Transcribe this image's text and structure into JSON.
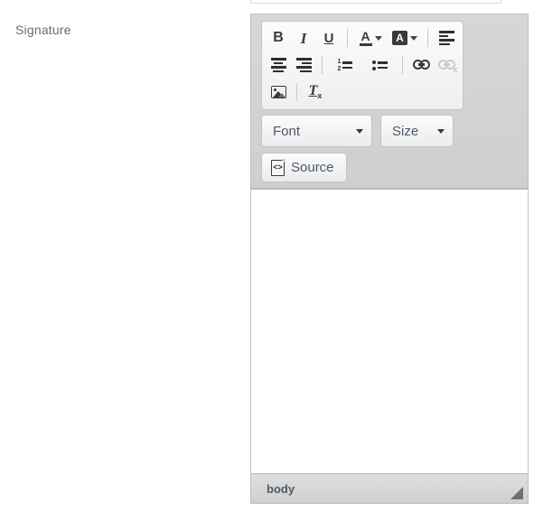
{
  "form": {
    "label": "Signature"
  },
  "editor": {
    "toolbar": {
      "row1": [
        {
          "name": "bold",
          "glyph": "B",
          "title": "Bold",
          "enabled": true
        },
        {
          "name": "italic",
          "glyph": "I",
          "title": "Italic",
          "enabled": true
        },
        {
          "name": "underline",
          "glyph": "U",
          "title": "Underline",
          "enabled": true
        },
        {
          "name": "text-color",
          "glyph": "A",
          "title": "Text Color",
          "enabled": true
        },
        {
          "name": "bg-color",
          "glyph": "A",
          "title": "Background Color",
          "enabled": true
        },
        {
          "name": "align-left",
          "glyph": "",
          "title": "Align Left",
          "enabled": true
        }
      ],
      "row2": [
        {
          "name": "align-center",
          "title": "Center",
          "enabled": true
        },
        {
          "name": "align-right",
          "title": "Align Right",
          "enabled": true
        },
        {
          "name": "numbered-list",
          "title": "Numbered List",
          "enabled": true
        },
        {
          "name": "bulleted-list",
          "title": "Bulleted List",
          "enabled": true
        },
        {
          "name": "link",
          "title": "Link",
          "enabled": true
        },
        {
          "name": "unlink",
          "title": "Unlink",
          "enabled": false
        }
      ],
      "row3": [
        {
          "name": "image",
          "title": "Image",
          "enabled": true
        },
        {
          "name": "remove-format",
          "title": "Remove Format",
          "enabled": true
        }
      ],
      "list_markers": {
        "numbered": [
          "1",
          "2"
        ]
      },
      "remove_format_glyph": {
        "letter": "T",
        "subscript": "x"
      }
    },
    "combos": [
      {
        "name": "font",
        "label": "Font"
      },
      {
        "name": "size",
        "label": "Size"
      }
    ],
    "source_button": {
      "label": "Source",
      "icon_glyph": "<>"
    },
    "content": "",
    "statusbar": {
      "element_path": "body"
    }
  },
  "colors": {
    "toolbar_bg": "#d4d4d4",
    "panel_bg": "#f5f5f5",
    "editor_border": "#c0c0c0",
    "label_text": "#6b6b6b",
    "combo_text": "#4b5a6a",
    "icon_dark": "#3a3a3a",
    "icon_disabled": "#9a9a9a",
    "canvas": "#ffffff",
    "statusbar_bg": "#d6d6d6",
    "grip": "#6f6f6f"
  }
}
